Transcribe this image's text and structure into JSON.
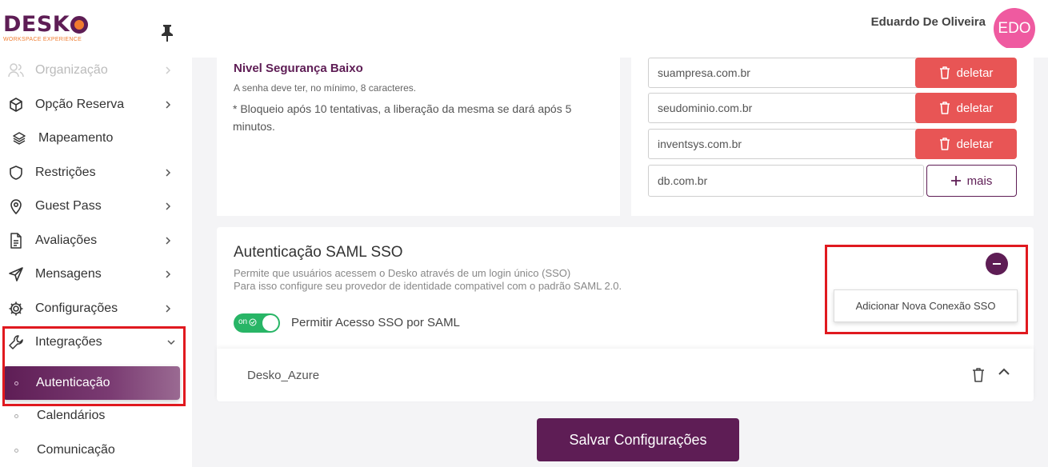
{
  "brand": {
    "name": "DESK",
    "name_o": "O",
    "tagline": "WORKSPACE EXPERIENCE",
    "primary": "#5e1d55",
    "accent": "#f07b2e"
  },
  "header": {
    "user_name": "Eduardo De Oliveira",
    "avatar_initials": "EDO",
    "avatar_color": "#ef5aa0"
  },
  "sidebar": {
    "items": [
      {
        "label": "Organização",
        "icon": "users-icon",
        "chevron": "right"
      },
      {
        "label": "Opção Reserva",
        "icon": "cube-icon",
        "chevron": "right"
      },
      {
        "label": "Mapeamento",
        "icon": "layers-icon",
        "chevron": ""
      },
      {
        "label": "Restrições",
        "icon": "shield-icon",
        "chevron": "right"
      },
      {
        "label": "Guest Pass",
        "icon": "map-pin-icon",
        "chevron": "right"
      },
      {
        "label": "Avaliações",
        "icon": "document-icon",
        "chevron": "right"
      },
      {
        "label": "Mensagens",
        "icon": "send-icon",
        "chevron": "right"
      },
      {
        "label": "Configurações",
        "icon": "gear-icon",
        "chevron": "right"
      },
      {
        "label": "Integrações",
        "icon": "wrench-icon",
        "chevron": "down"
      }
    ],
    "sub_items": [
      {
        "label": "Autenticação",
        "active": true
      },
      {
        "label": "Calendários",
        "active": false
      },
      {
        "label": "Comunicação",
        "active": false
      }
    ]
  },
  "security": {
    "title": "Nivel Segurança Baixo",
    "line1": "A senha deve ter, no mínimo, 8 caracteres.",
    "line2": "* Bloqueio após 10 tentativas, a liberação da mesma se dará após 5 minutos."
  },
  "domains": {
    "items": [
      "suampresa.com.br",
      "seudominio.com.br",
      "inventsys.com.br",
      "db.com.br"
    ],
    "delete_label": "deletar",
    "more_label": "mais",
    "delete_color": "#e85555"
  },
  "saml": {
    "title": "Autenticação SAML SSO",
    "desc1": "Permite que usuários acessem o Desko através de um login único (SSO)",
    "desc2": "Para isso configure seu provedor de identidade compativel com o padrão SAML 2.0.",
    "toggle_text": "on",
    "toggle_on": true,
    "toggle_label": "Permitir Acesso SSO por SAML",
    "add_connection_label": "Adicionar Nova Conexão SSO",
    "connections": [
      "Desko_Azure"
    ]
  },
  "footer": {
    "save_label": "Salvar Configurações"
  }
}
